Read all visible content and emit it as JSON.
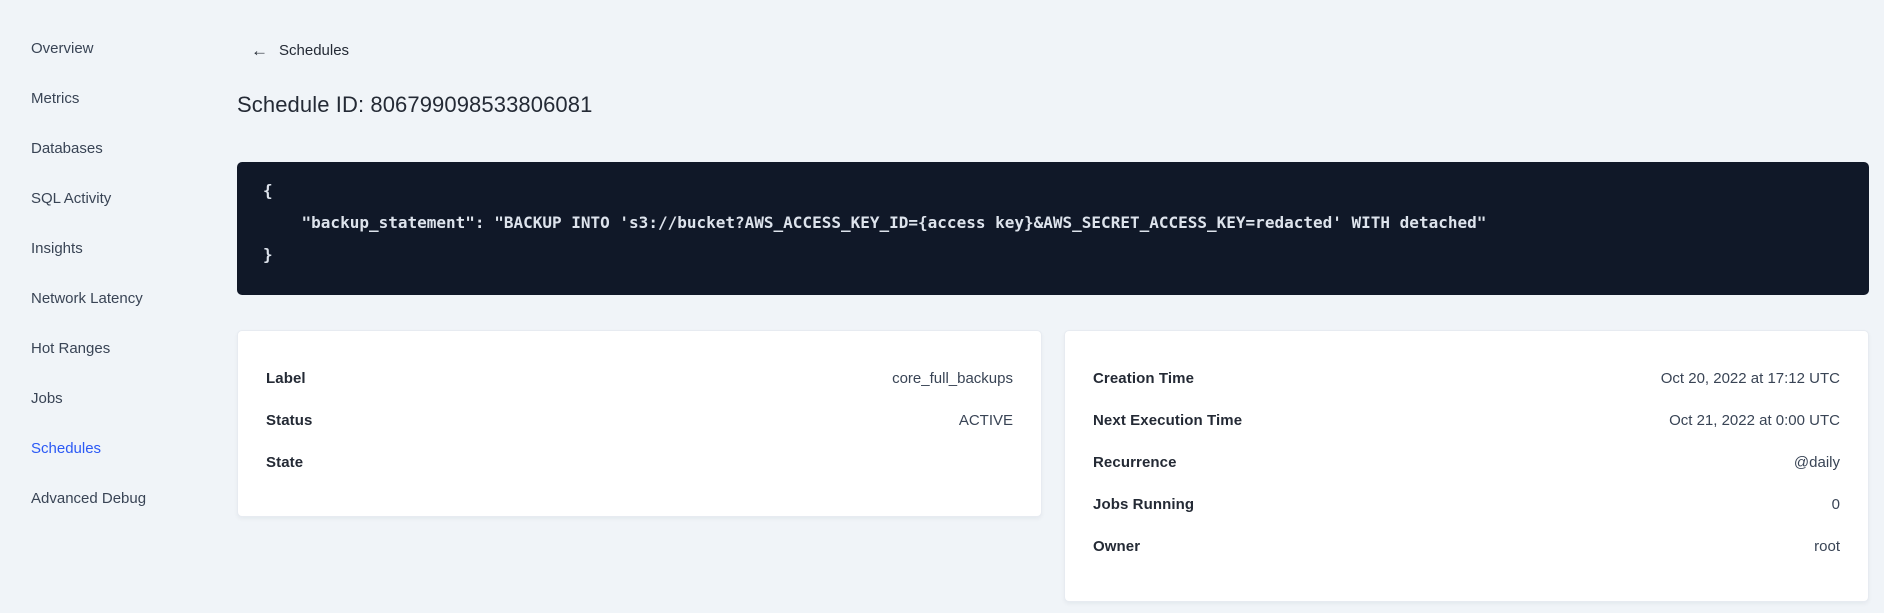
{
  "sidebar": {
    "items": [
      {
        "label": "Overview",
        "active": false
      },
      {
        "label": "Metrics",
        "active": false
      },
      {
        "label": "Databases",
        "active": false
      },
      {
        "label": "SQL Activity",
        "active": false
      },
      {
        "label": "Insights",
        "active": false
      },
      {
        "label": "Network Latency",
        "active": false
      },
      {
        "label": "Hot Ranges",
        "active": false
      },
      {
        "label": "Jobs",
        "active": false
      },
      {
        "label": "Schedules",
        "active": true
      },
      {
        "label": "Advanced Debug",
        "active": false
      }
    ]
  },
  "header": {
    "back_icon": "←",
    "back_label": "Schedules",
    "title": "Schedule ID: 806799098533806081"
  },
  "code_block": {
    "lines": [
      "{",
      "    \"backup_statement\": \"BACKUP INTO 's3://bucket?AWS_ACCESS_KEY_ID={access key}&AWS_SECRET_ACCESS_KEY=redacted' WITH detached\"",
      "}"
    ]
  },
  "details_left": {
    "rows": [
      {
        "label": "Label",
        "value": "core_full_backups"
      },
      {
        "label": "Status",
        "value": "ACTIVE"
      },
      {
        "label": "State",
        "value": ""
      }
    ]
  },
  "details_right": {
    "rows": [
      {
        "label": "Creation Time",
        "value": "Oct 20, 2022 at 17:12 UTC"
      },
      {
        "label": "Next Execution Time",
        "value": "Oct 21, 2022 at 0:00 UTC"
      },
      {
        "label": "Recurrence",
        "value": "@daily"
      },
      {
        "label": "Jobs Running",
        "value": "0"
      },
      {
        "label": "Owner",
        "value": "root"
      }
    ]
  },
  "colors": {
    "page_background": "#f0f4f8",
    "code_background": "#101828",
    "code_text": "#dde3ec",
    "nav_active": "#2b59f5",
    "text_primary": "#242a35",
    "text_secondary": "#394455",
    "card_background": "#ffffff"
  }
}
